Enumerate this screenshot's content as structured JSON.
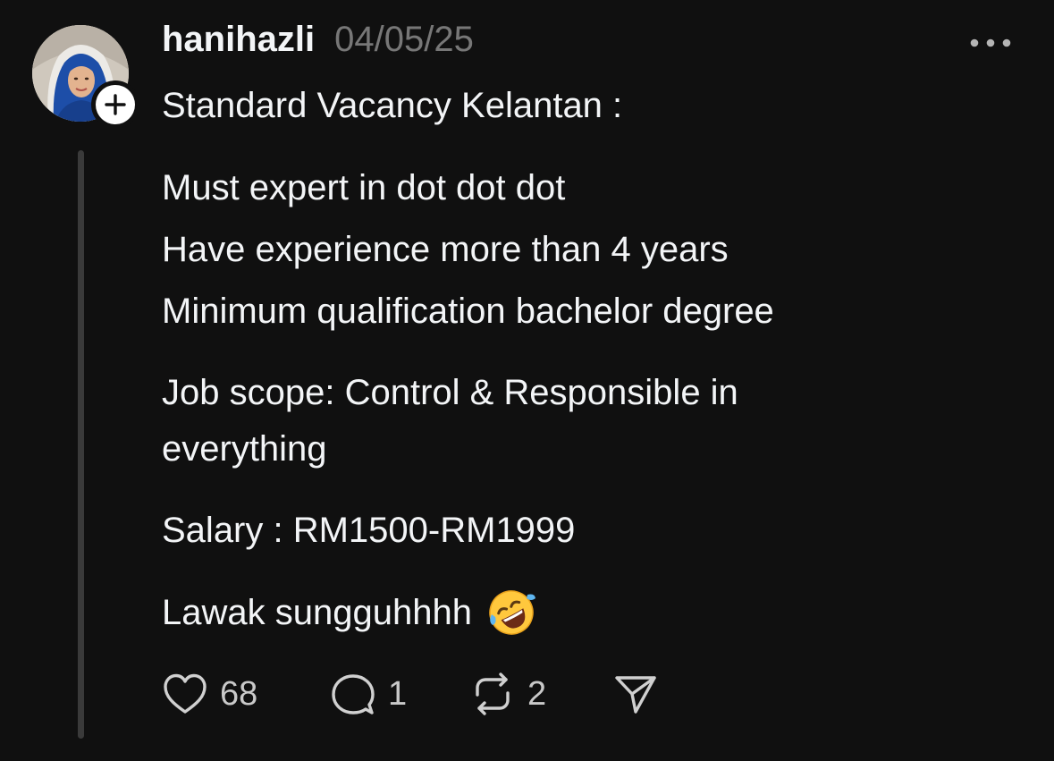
{
  "post": {
    "username": "hanihazli",
    "date": "04/05/25",
    "lines": [
      "Standard Vacancy Kelantan :",
      "Must expert in dot dot dot",
      "Have experience more than 4 years",
      "Minimum qualification bachelor degree",
      "Job scope: Control & Responsible in",
      "everything",
      "Salary : RM1500-RM1999",
      "Lawak sungguhhhh"
    ],
    "emoji": "rolling-on-floor-laughing"
  },
  "actions": {
    "likes": "68",
    "replies": "1",
    "reposts": "2"
  },
  "icons": {
    "like": "heart-icon",
    "reply": "comment-icon",
    "repost": "repost-icon",
    "share": "send-icon",
    "more": "more-icon",
    "follow": "plus-icon"
  },
  "colors": {
    "background": "#101010",
    "text": "#f3f5f7",
    "muted": "#777777",
    "thread_line": "#3a3a3a"
  }
}
